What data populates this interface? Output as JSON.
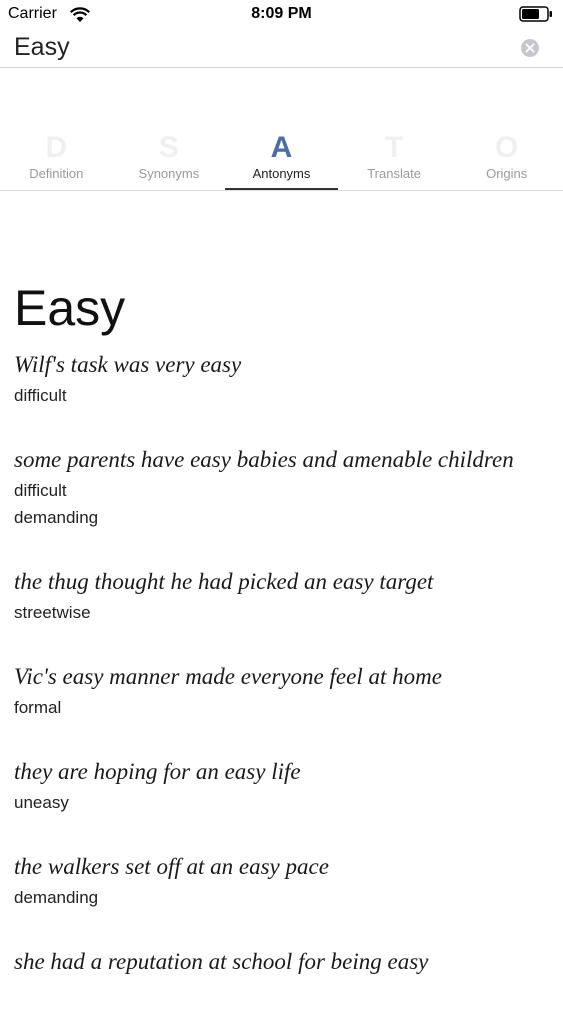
{
  "status_bar": {
    "carrier": "Carrier",
    "time": "8:09 PM",
    "icons": [
      "wifi-icon",
      "battery-icon"
    ]
  },
  "search": {
    "value": "Easy",
    "placeholder": "",
    "clear_icon": "clear-icon"
  },
  "tabs": [
    {
      "letter": "D",
      "label": "Definition",
      "active": false
    },
    {
      "letter": "S",
      "label": "Synonyms",
      "active": false
    },
    {
      "letter": "A",
      "label": "Antonyms",
      "active": true
    },
    {
      "letter": "T",
      "label": "Translate",
      "active": false
    },
    {
      "letter": "O",
      "label": "Origins",
      "active": false
    }
  ],
  "colors": {
    "active_tab_letter": "#4a6fa0",
    "inactive_tab_letter": "#f0f0f0"
  },
  "headword": "Easy",
  "entries": [
    {
      "example": "Wilf's task was very easy",
      "antonyms": [
        "difficult"
      ]
    },
    {
      "example": "some parents have easy babies and amenable children",
      "antonyms": [
        "difficult",
        "demanding"
      ]
    },
    {
      "example": "the thug thought he had picked an easy target",
      "antonyms": [
        "streetwise"
      ]
    },
    {
      "example": "Vic's easy manner made everyone feel at home",
      "antonyms": [
        "formal"
      ]
    },
    {
      "example": "they are hoping for an easy life",
      "antonyms": [
        "uneasy"
      ]
    },
    {
      "example": "the walkers set off at an easy pace",
      "antonyms": [
        "demanding"
      ]
    },
    {
      "example": "she had a reputation at school for being easy",
      "antonyms": []
    }
  ]
}
